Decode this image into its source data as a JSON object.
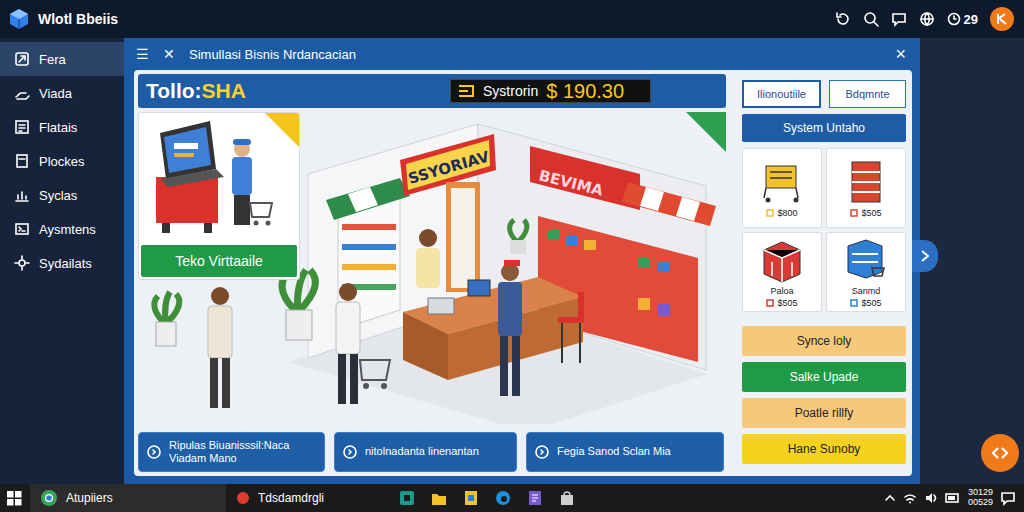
{
  "app": {
    "logo_text": "Wlotl Bbeiis",
    "clock": "29"
  },
  "sidebar": {
    "items": [
      {
        "label": "Fera",
        "selected": true
      },
      {
        "label": "Viada",
        "selected": false
      },
      {
        "label": "Flatais",
        "selected": false
      },
      {
        "label": "Plockes",
        "selected": false
      },
      {
        "label": "Syclas",
        "selected": false
      },
      {
        "label": "Aysmtens",
        "selected": false
      },
      {
        "label": "Sydailats",
        "selected": false
      }
    ]
  },
  "window": {
    "menu_icon": "☰",
    "back_icon": "✕",
    "title": "Simullasi Bisnis Nrdancacian",
    "close_icon": "×"
  },
  "store": {
    "name_a": "Tollo:",
    "name_b": "SHA",
    "balance_label": "Systrorin",
    "balance": "$ 190.30"
  },
  "scene": {
    "card_label": "Teko Virttaaile",
    "signs": [
      "SSYORIAV",
      "BEVIMA"
    ]
  },
  "bottom_buttons": [
    {
      "label": "Ripulas Biuanisssil:Naca Viadam Mano"
    },
    {
      "label": "nitolnadanta linenantan"
    },
    {
      "label": "Fegia Sanod Sclan Mia"
    }
  ],
  "side_panel": {
    "tabs": [
      {
        "label": "Ilionoutiile",
        "selected": true
      },
      {
        "label": "Bdqmnte",
        "selected": false
      }
    ],
    "header": "System Untaho",
    "products": [
      {
        "price": "$800",
        "color": "#f2c12e"
      },
      {
        "price": "$505",
        "color": "#d9462e"
      },
      {
        "name": "Paloa",
        "price": "$505",
        "color": "#d93a34"
      },
      {
        "name": "Sanmd",
        "price": "$505",
        "color": "#2f7fd6"
      }
    ],
    "actions": [
      {
        "label": "Synce loly",
        "color": "#f7c77a"
      },
      {
        "label": "Salke Upade",
        "color": "#1f9a46"
      },
      {
        "label": "Poatle rillfy",
        "color": "#f7c77a"
      },
      {
        "label": "Hane Sunoby",
        "color": "#f5d21e"
      }
    ]
  },
  "taskbar": {
    "items": [
      {
        "label": "Atupiiers",
        "selected": true
      },
      {
        "label": "Tdsdamdrgli",
        "selected": false
      }
    ],
    "time": "30129",
    "date": "00529"
  }
}
